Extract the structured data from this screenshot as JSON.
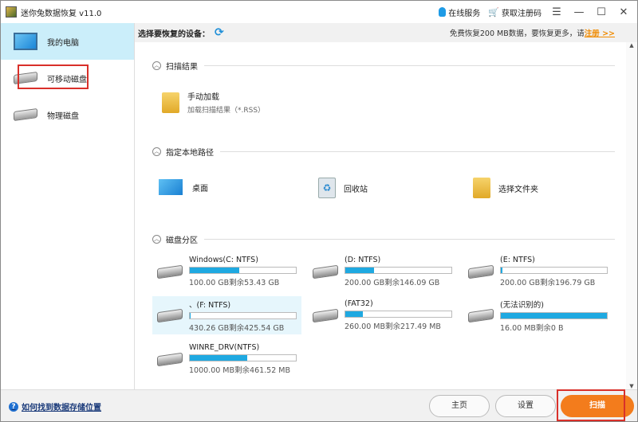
{
  "window": {
    "title": "迷你兔数据恢复 v11.0",
    "online_service": "在线服务",
    "get_code": "获取注册码"
  },
  "sidebar": {
    "items": [
      {
        "label": "我的电脑"
      },
      {
        "label": "可移动磁盘"
      },
      {
        "label": "物理磁盘"
      }
    ]
  },
  "toolbar": {
    "select_device": "选择要恢复的设备：",
    "promo_text": "免费恢复200 MB数据，要恢复更多，请",
    "register_link": "注册 >>"
  },
  "sections": {
    "scan_results": {
      "title": "扫描结果",
      "item_title": "手动加载",
      "item_sub": "加载扫描结果（*.RSS）"
    },
    "local_path": {
      "title": "指定本地路径",
      "items": [
        {
          "label": "桌面"
        },
        {
          "label": "回收站"
        },
        {
          "label": "选择文件夹"
        }
      ]
    },
    "partitions": {
      "title": "磁盘分区",
      "disks": [
        {
          "name": "Windows(C: NTFS)",
          "size": "100.00 GB剩余53.43 GB",
          "used_pct": 46.6
        },
        {
          "name": "(D: NTFS)",
          "size": "200.00 GB剩余146.09 GB",
          "used_pct": 27
        },
        {
          "name": "(E: NTFS)",
          "size": "200.00 GB剩余196.79 GB",
          "used_pct": 1.6
        },
        {
          "name": "、(F: NTFS)",
          "size": "430.26 GB剩余425.54 GB",
          "used_pct": 1.1
        },
        {
          "name": "(FAT32)",
          "size": "260.00 MB剩余217.49 MB",
          "used_pct": 16.3
        },
        {
          "name": "(无法识别的)",
          "size": "16.00 MB剩余0 B",
          "used_pct": 100
        },
        {
          "name": "WINRE_DRV(NTFS)",
          "size": "1000.00 MB剩余461.52 MB",
          "used_pct": 53.8
        }
      ]
    }
  },
  "footer": {
    "help": "如何找到数据存储位置",
    "home": "主页",
    "settings": "设置",
    "scan": "扫描"
  }
}
